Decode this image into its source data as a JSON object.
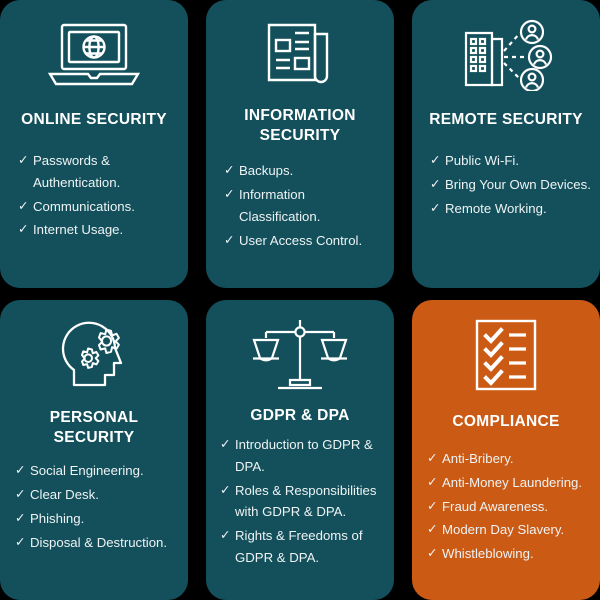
{
  "theme": {
    "background": "#000000",
    "card_teal": "#13505B",
    "card_orange": "#CB5A15",
    "text": "#FFFFFF",
    "bullet_text": "#EEF3F4"
  },
  "cards": [
    {
      "id": "online-security",
      "title": "ONLINE SECURITY",
      "icon": "laptop-globe-icon",
      "color": "#13505B",
      "bullets": [
        "Passwords & Authentication.",
        "Communications.",
        "Internet Usage."
      ]
    },
    {
      "id": "information-security",
      "title": "INFORMATION SECURITY",
      "icon": "newspaper-document-icon",
      "color": "#13505B",
      "bullets": [
        "Backups.",
        "Information Classification.",
        "User Access Control."
      ]
    },
    {
      "id": "remote-security",
      "title": "REMOTE SECURITY",
      "icon": "office-building-users-network-icon",
      "color": "#13505B",
      "bullets": [
        "Public Wi-Fi.",
        "Bring Your Own Devices.",
        "Remote Working."
      ]
    },
    {
      "id": "personal-security",
      "title": "PERSONAL SECURITY",
      "icon": "head-gears-icon",
      "color": "#13505B",
      "bullets": [
        "Social Engineering.",
        "Clear Desk.",
        "Phishing.",
        "Disposal & Destruction."
      ]
    },
    {
      "id": "gdpr-dpa",
      "title": "GDPR & DPA",
      "icon": "scales-of-justice-icon",
      "color": "#13505B",
      "bullets": [
        "Introduction to GDPR & DPA.",
        "Roles & Responsibilities with GDPR & DPA.",
        "Rights & Freedoms of GDPR & DPA."
      ]
    },
    {
      "id": "compliance",
      "title": "COMPLIANCE",
      "icon": "checklist-clipboard-icon",
      "color": "#CB5A15",
      "bullets": [
        "Anti-Bribery.",
        "Anti-Money Laundering.",
        "Fraud Awareness.",
        "Modern Day Slavery.",
        "Whistleblowing."
      ]
    }
  ],
  "bullet_marker": "✓"
}
